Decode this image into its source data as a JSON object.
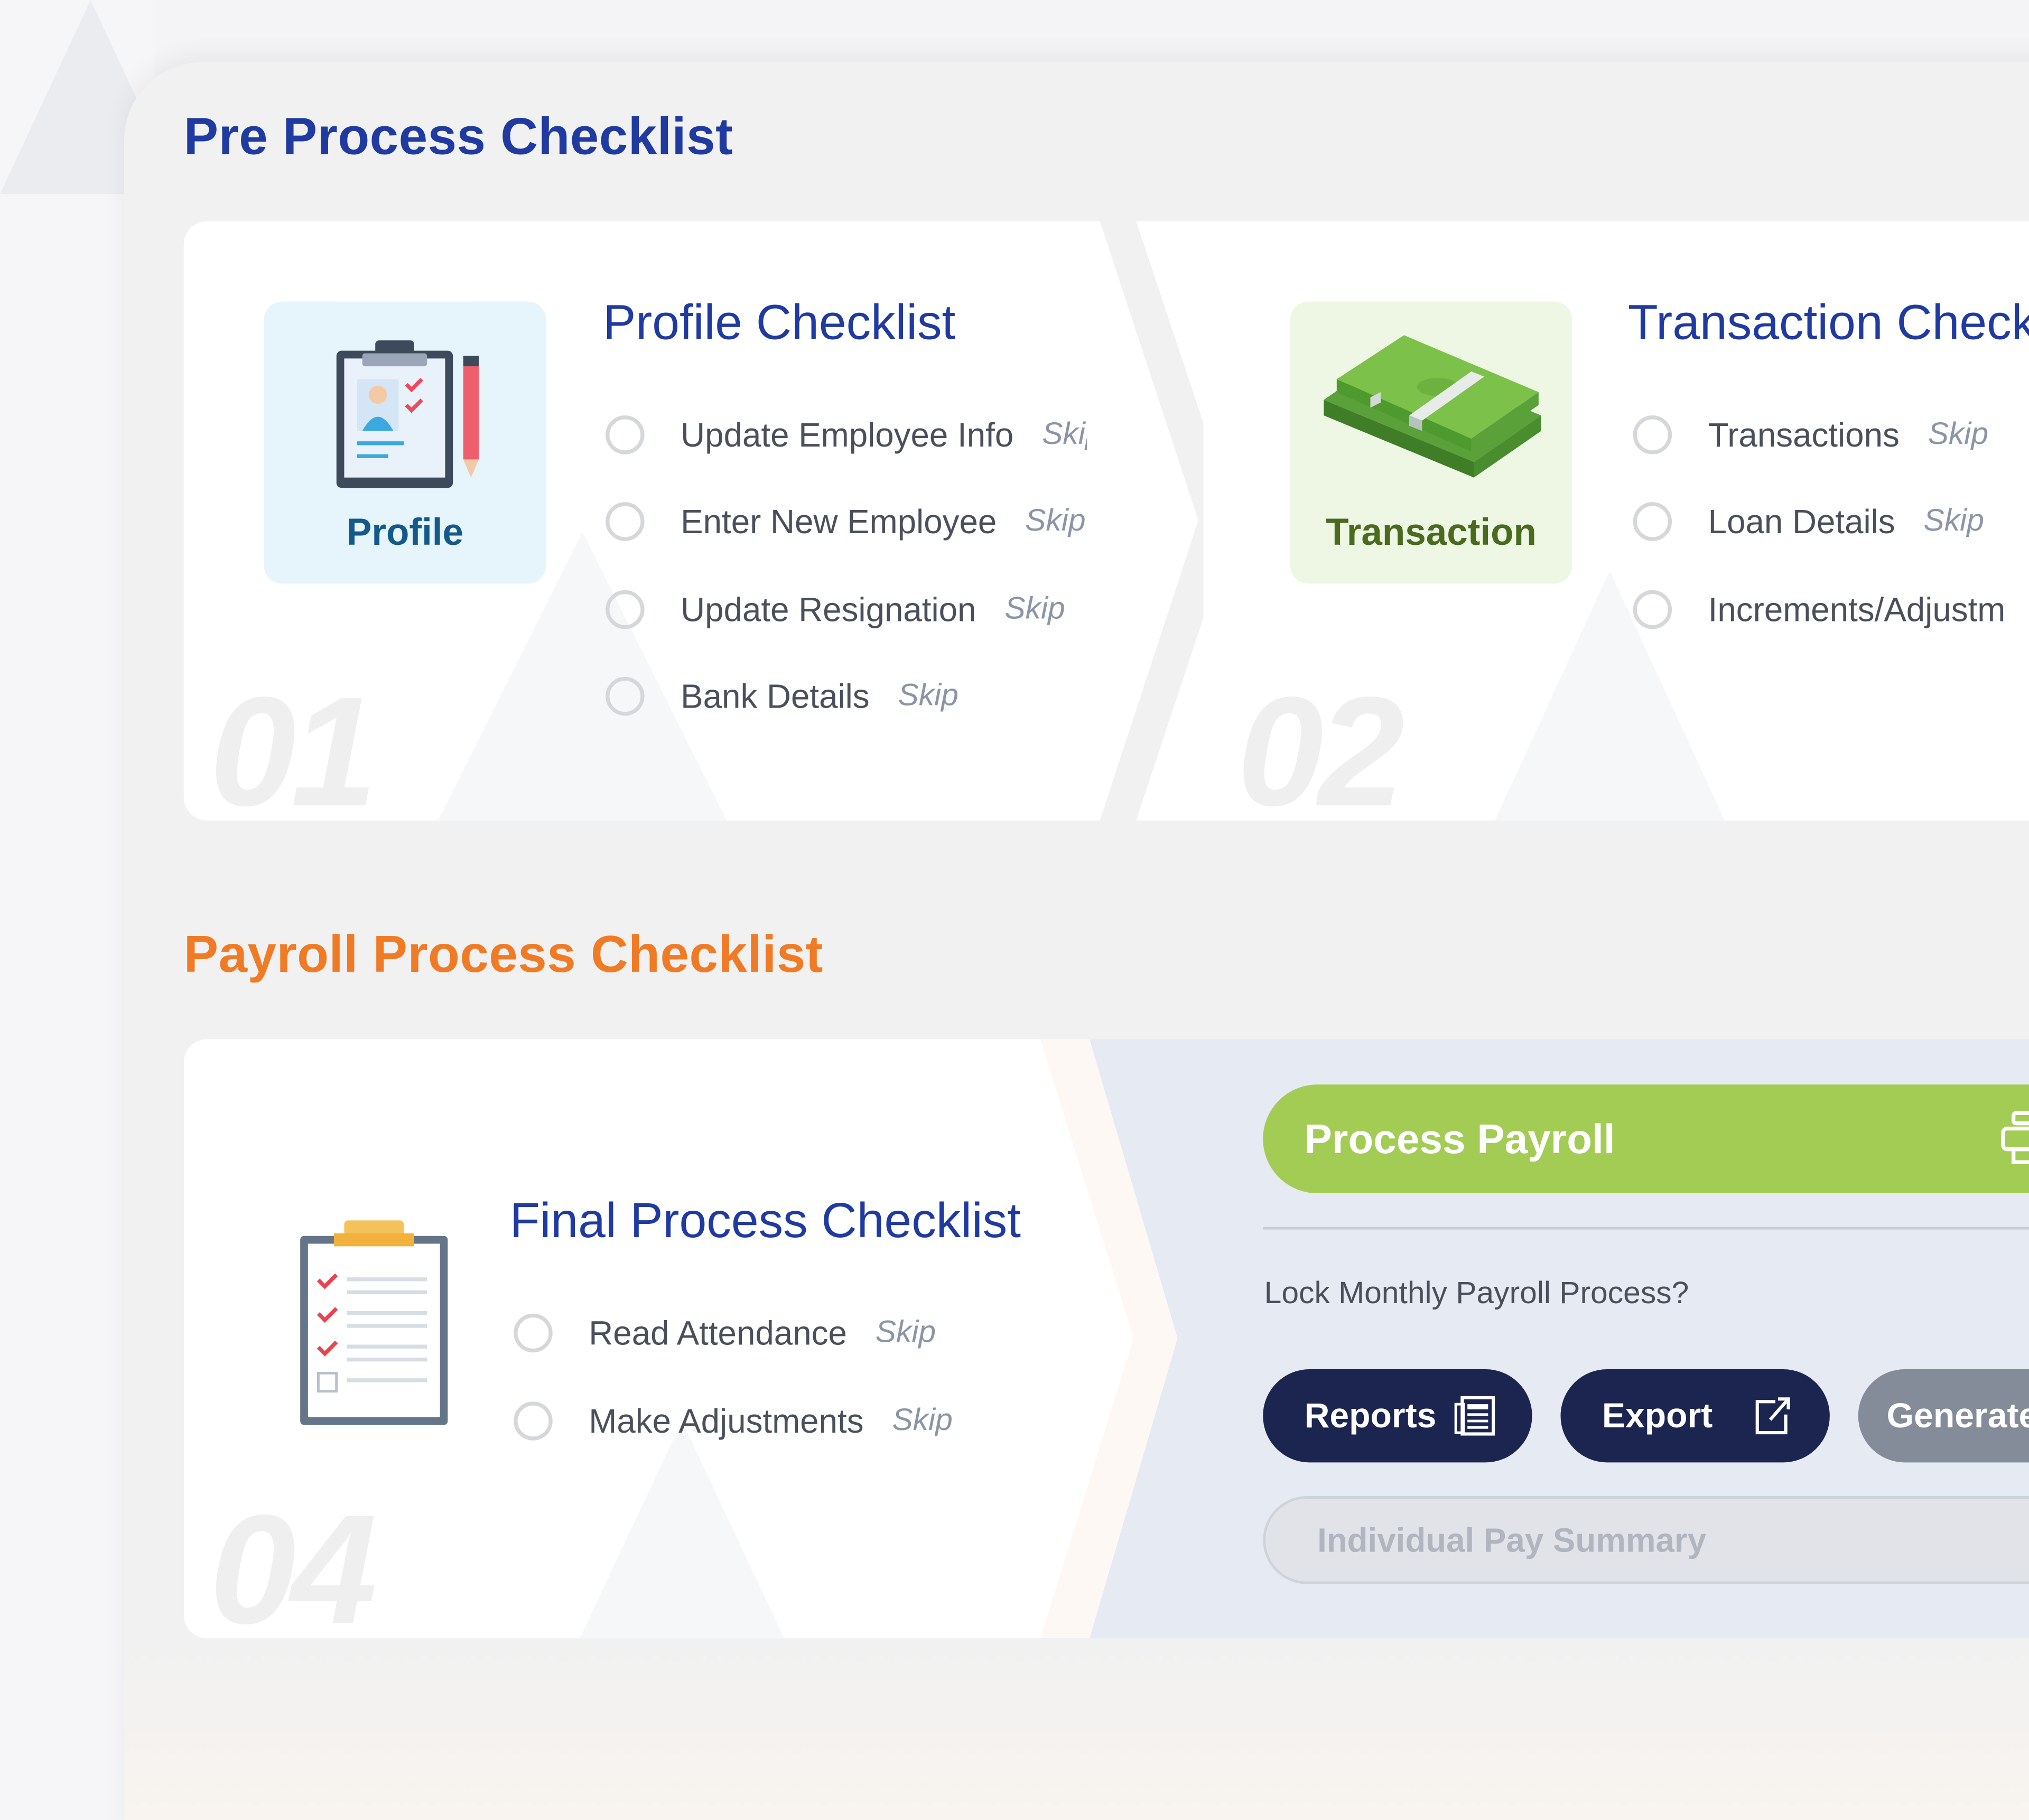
{
  "pre_process": {
    "title": "Pre Process Checklist",
    "profile_card": {
      "number": "01",
      "icon": "profile-clipboard-icon",
      "icon_label": "Profile",
      "heading": "Profile Checklist",
      "items": [
        {
          "label": "Update Employee Info",
          "skip": "Skip"
        },
        {
          "label": "Enter New Employee",
          "skip": "Skip"
        },
        {
          "label": "Update Resignation",
          "skip": "Skip"
        },
        {
          "label": "Bank Details",
          "skip": "Skip"
        }
      ]
    },
    "transaction_card": {
      "number": "02",
      "icon": "money-stack-icon",
      "icon_label": "Transaction",
      "heading": "Transaction Check",
      "items": [
        {
          "label": "Transactions",
          "skip": "Skip"
        },
        {
          "label": "Loan Details",
          "skip": "Skip"
        },
        {
          "label": "Increments/Adjustm",
          "skip": ""
        }
      ]
    }
  },
  "payroll_process": {
    "title": "Payroll Process Checklist",
    "final_card": {
      "number": "04",
      "icon": "checklist-clipboard-icon",
      "heading": "Final Process Checklist",
      "items": [
        {
          "label": "Read Attendance",
          "skip": "Skip"
        },
        {
          "label": "Make Adjustments",
          "skip": "Skip"
        }
      ]
    },
    "actions": {
      "process_payroll": "Process Payroll",
      "lock_question": "Lock Monthly Payroll Process?",
      "reports": "Reports",
      "export": "Export",
      "generate": "Generate",
      "individual_pay_summary": "Individual Pay Summary"
    }
  },
  "colors": {
    "navy": "#1f3aa0",
    "orange": "#f07b24",
    "green": "#a3cc55",
    "dark_button": "#1b2550",
    "grey_button": "#848b99"
  }
}
